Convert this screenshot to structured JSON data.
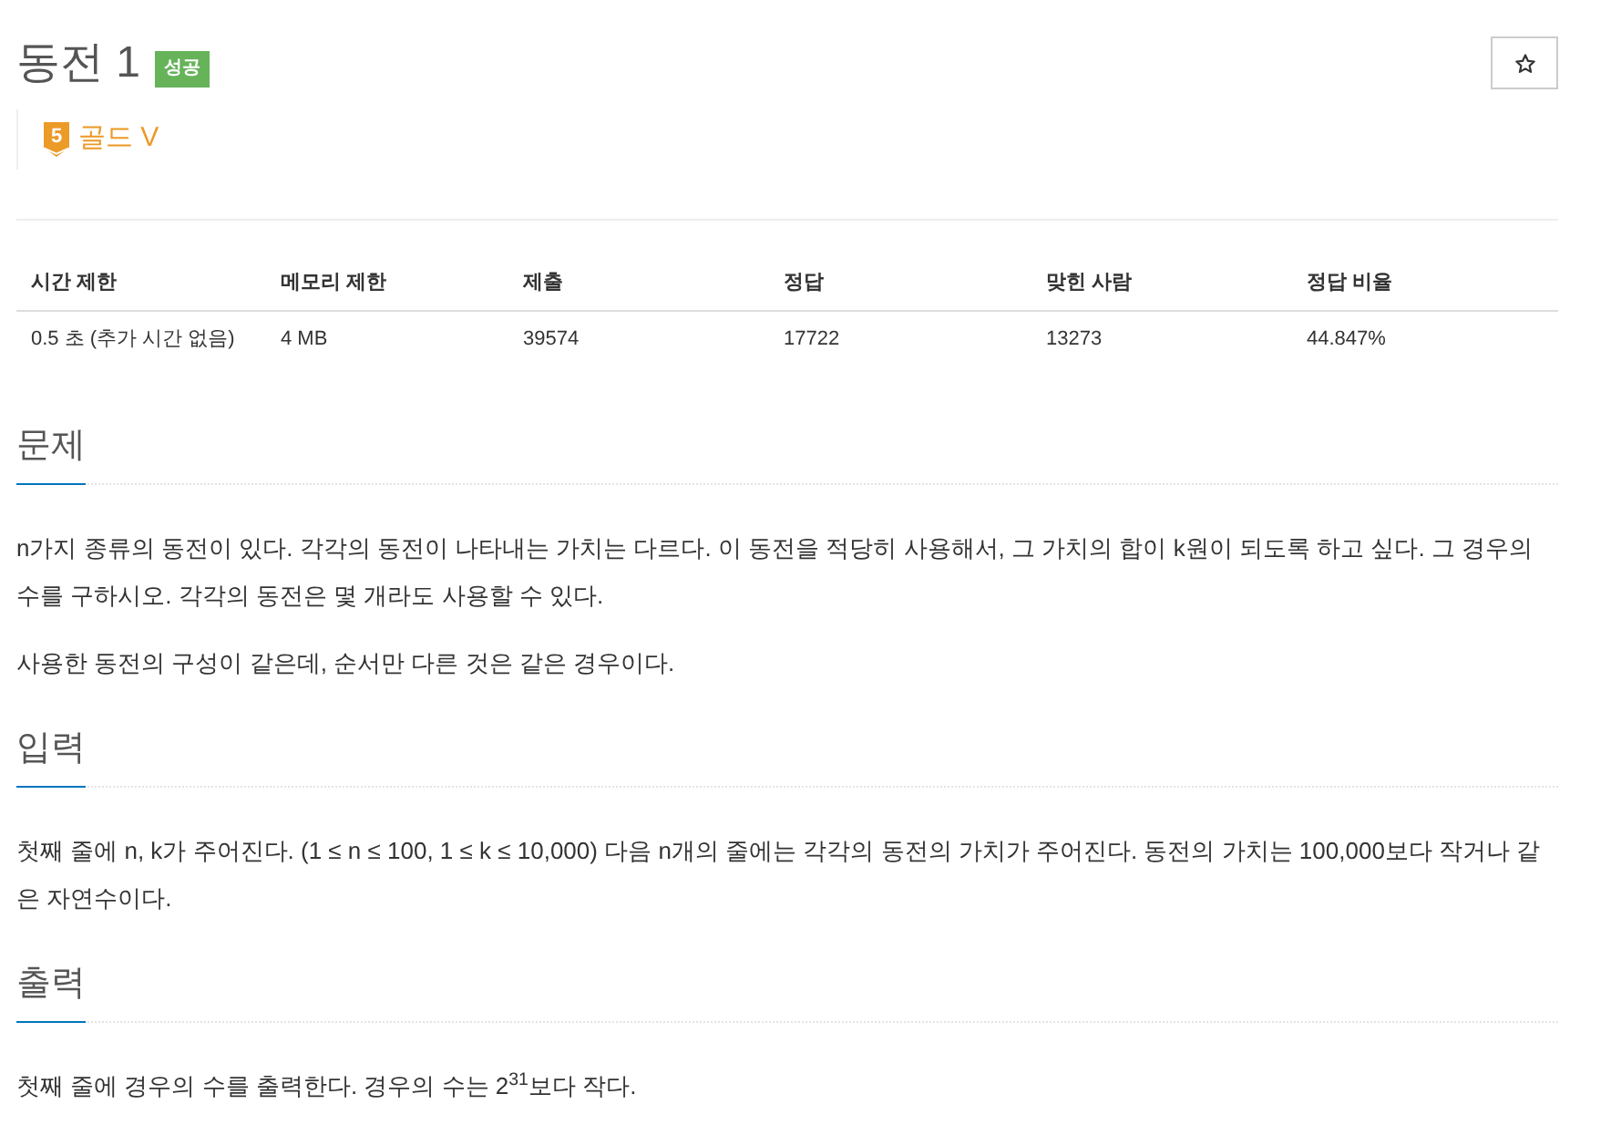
{
  "problem": {
    "title": "동전 1",
    "result_badge": "성공",
    "starred": false
  },
  "tier": {
    "badge_number": "5",
    "label": "골드 V"
  },
  "table": {
    "columns": [
      "시간 제한",
      "메모리 제한",
      "제출",
      "정답",
      "맞힌 사람",
      "정답 비율"
    ],
    "rows": [
      [
        "0.5 초 (추가 시간 없음)",
        "4 MB",
        "39574",
        "17722",
        "13273",
        "44.847%"
      ]
    ]
  },
  "sections": [
    {
      "heading": "문제",
      "paragraphs": [
        "n가지 종류의 동전이 있다. 각각의 동전이 나타내는 가치는 다르다. 이 동전을 적당히 사용해서, 그 가치의 합이 k원이 되도록 하고 싶다. 그 경우의 수를 구하시오. 각각의 동전은 몇 개라도 사용할 수 있다.",
        "사용한 동전의 구성이 같은데, 순서만 다른 것은 같은 경우이다."
      ]
    },
    {
      "heading": "입력",
      "paragraphs": [
        "첫째 줄에 n, k가 주어진다. (1 ≤ n ≤ 100, 1 ≤ k ≤ 10,000) 다음 n개의 줄에는 각각의 동전의 가치가 주어진다. 동전의 가치는 100,000보다 작거나 같은 자연수이다."
      ]
    },
    {
      "heading": "출력",
      "paragraphs": [
        "첫째 줄에 경우의 수를 출력한다. 경우의 수는 2$^{31}$보다 작다."
      ]
    }
  ]
}
